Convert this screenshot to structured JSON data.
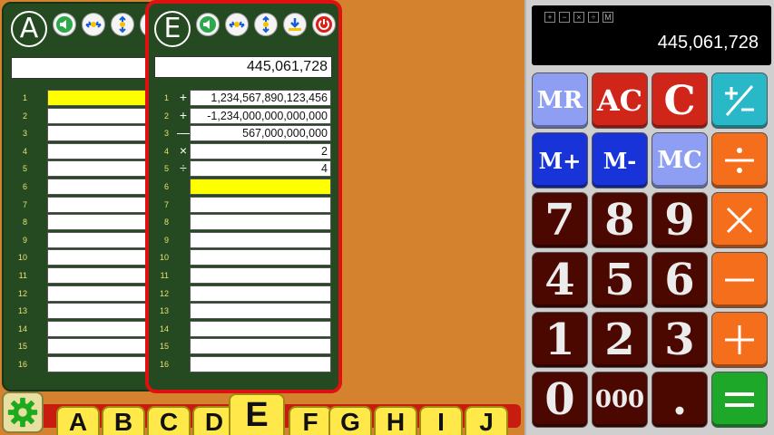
{
  "tape_a": {
    "letter": "A",
    "total": "",
    "rows": [
      {
        "num": "1",
        "op": "",
        "value": "",
        "active": true
      },
      {
        "num": "2",
        "op": "",
        "value": ""
      },
      {
        "num": "3",
        "op": "",
        "value": ""
      },
      {
        "num": "4",
        "op": "",
        "value": ""
      },
      {
        "num": "5",
        "op": "",
        "value": ""
      },
      {
        "num": "6",
        "op": "",
        "value": ""
      },
      {
        "num": "7",
        "op": "",
        "value": ""
      },
      {
        "num": "8",
        "op": "",
        "value": ""
      },
      {
        "num": "9",
        "op": "",
        "value": ""
      },
      {
        "num": "10",
        "op": "",
        "value": ""
      },
      {
        "num": "11",
        "op": "",
        "value": ""
      },
      {
        "num": "12",
        "op": "",
        "value": ""
      },
      {
        "num": "13",
        "op": "",
        "value": ""
      },
      {
        "num": "14",
        "op": "",
        "value": ""
      },
      {
        "num": "15",
        "op": "",
        "value": ""
      },
      {
        "num": "16",
        "op": "",
        "value": ""
      }
    ]
  },
  "tape_e": {
    "letter": "E",
    "total": "445,061,728",
    "rows": [
      {
        "num": "1",
        "op": "+",
        "value": "1,234,567,890,123,456"
      },
      {
        "num": "2",
        "op": "+",
        "value": "-1,234,000,000,000,000"
      },
      {
        "num": "3",
        "op": "—",
        "value": "567,000,000,000"
      },
      {
        "num": "4",
        "op": "×",
        "value": "2"
      },
      {
        "num": "5",
        "op": "÷",
        "value": "4"
      },
      {
        "num": "6",
        "op": "",
        "value": "",
        "active": true
      },
      {
        "num": "7",
        "op": "",
        "value": ""
      },
      {
        "num": "8",
        "op": "",
        "value": ""
      },
      {
        "num": "9",
        "op": "",
        "value": ""
      },
      {
        "num": "10",
        "op": "",
        "value": ""
      },
      {
        "num": "11",
        "op": "",
        "value": ""
      },
      {
        "num": "12",
        "op": "",
        "value": ""
      },
      {
        "num": "13",
        "op": "",
        "value": ""
      },
      {
        "num": "14",
        "op": "",
        "value": ""
      },
      {
        "num": "15",
        "op": "",
        "value": ""
      },
      {
        "num": "16",
        "op": "",
        "value": ""
      }
    ]
  },
  "tools": [
    "speaker-icon",
    "collapse-icon",
    "expand-icon",
    "download-icon",
    "power-icon"
  ],
  "tabs": [
    "A",
    "B",
    "C",
    "D",
    "E",
    "F",
    "G",
    "H",
    "I",
    "J"
  ],
  "selected_tab": "E",
  "calculator": {
    "display": "445,061,728",
    "indicators": [
      "+",
      "−",
      "×",
      "÷",
      "M"
    ],
    "keys": {
      "mr": "MR",
      "ac": "AC",
      "c": "C",
      "mplus": "M+",
      "mminus": "M-",
      "mc": "MC",
      "seven": "7",
      "eight": "8",
      "nine": "9",
      "four": "4",
      "five": "5",
      "six": "6",
      "one": "1",
      "two": "2",
      "three": "3",
      "zero": "0",
      "triple_zero": "000",
      "decimal": "."
    }
  },
  "colors": {
    "background": "#d4822e",
    "tape_bg": "#254a22",
    "active_border": "#e01010",
    "active_row": "#ffff00",
    "key_memory": "#8e9ef2",
    "key_clear": "#d0261a",
    "key_mem_add": "#1833d8",
    "key_digit": "#4a0800",
    "key_operator": "#f46e1c",
    "key_sign": "#28b8c8",
    "key_equals": "#1ea82a"
  }
}
